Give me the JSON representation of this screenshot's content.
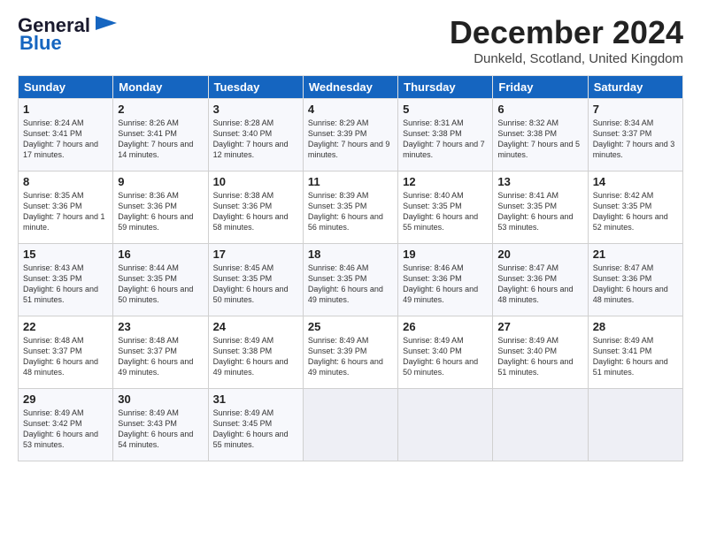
{
  "header": {
    "logo_line1": "General",
    "logo_line2": "Blue",
    "month": "December 2024",
    "location": "Dunkeld, Scotland, United Kingdom"
  },
  "weekdays": [
    "Sunday",
    "Monday",
    "Tuesday",
    "Wednesday",
    "Thursday",
    "Friday",
    "Saturday"
  ],
  "weeks": [
    [
      {
        "day": "1",
        "sunrise": "Sunrise: 8:24 AM",
        "sunset": "Sunset: 3:41 PM",
        "daylight": "Daylight: 7 hours and 17 minutes."
      },
      {
        "day": "2",
        "sunrise": "Sunrise: 8:26 AM",
        "sunset": "Sunset: 3:41 PM",
        "daylight": "Daylight: 7 hours and 14 minutes."
      },
      {
        "day": "3",
        "sunrise": "Sunrise: 8:28 AM",
        "sunset": "Sunset: 3:40 PM",
        "daylight": "Daylight: 7 hours and 12 minutes."
      },
      {
        "day": "4",
        "sunrise": "Sunrise: 8:29 AM",
        "sunset": "Sunset: 3:39 PM",
        "daylight": "Daylight: 7 hours and 9 minutes."
      },
      {
        "day": "5",
        "sunrise": "Sunrise: 8:31 AM",
        "sunset": "Sunset: 3:38 PM",
        "daylight": "Daylight: 7 hours and 7 minutes."
      },
      {
        "day": "6",
        "sunrise": "Sunrise: 8:32 AM",
        "sunset": "Sunset: 3:38 PM",
        "daylight": "Daylight: 7 hours and 5 minutes."
      },
      {
        "day": "7",
        "sunrise": "Sunrise: 8:34 AM",
        "sunset": "Sunset: 3:37 PM",
        "daylight": "Daylight: 7 hours and 3 minutes."
      }
    ],
    [
      {
        "day": "8",
        "sunrise": "Sunrise: 8:35 AM",
        "sunset": "Sunset: 3:36 PM",
        "daylight": "Daylight: 7 hours and 1 minute."
      },
      {
        "day": "9",
        "sunrise": "Sunrise: 8:36 AM",
        "sunset": "Sunset: 3:36 PM",
        "daylight": "Daylight: 6 hours and 59 minutes."
      },
      {
        "day": "10",
        "sunrise": "Sunrise: 8:38 AM",
        "sunset": "Sunset: 3:36 PM",
        "daylight": "Daylight: 6 hours and 58 minutes."
      },
      {
        "day": "11",
        "sunrise": "Sunrise: 8:39 AM",
        "sunset": "Sunset: 3:35 PM",
        "daylight": "Daylight: 6 hours and 56 minutes."
      },
      {
        "day": "12",
        "sunrise": "Sunrise: 8:40 AM",
        "sunset": "Sunset: 3:35 PM",
        "daylight": "Daylight: 6 hours and 55 minutes."
      },
      {
        "day": "13",
        "sunrise": "Sunrise: 8:41 AM",
        "sunset": "Sunset: 3:35 PM",
        "daylight": "Daylight: 6 hours and 53 minutes."
      },
      {
        "day": "14",
        "sunrise": "Sunrise: 8:42 AM",
        "sunset": "Sunset: 3:35 PM",
        "daylight": "Daylight: 6 hours and 52 minutes."
      }
    ],
    [
      {
        "day": "15",
        "sunrise": "Sunrise: 8:43 AM",
        "sunset": "Sunset: 3:35 PM",
        "daylight": "Daylight: 6 hours and 51 minutes."
      },
      {
        "day": "16",
        "sunrise": "Sunrise: 8:44 AM",
        "sunset": "Sunset: 3:35 PM",
        "daylight": "Daylight: 6 hours and 50 minutes."
      },
      {
        "day": "17",
        "sunrise": "Sunrise: 8:45 AM",
        "sunset": "Sunset: 3:35 PM",
        "daylight": "Daylight: 6 hours and 50 minutes."
      },
      {
        "day": "18",
        "sunrise": "Sunrise: 8:46 AM",
        "sunset": "Sunset: 3:35 PM",
        "daylight": "Daylight: 6 hours and 49 minutes."
      },
      {
        "day": "19",
        "sunrise": "Sunrise: 8:46 AM",
        "sunset": "Sunset: 3:36 PM",
        "daylight": "Daylight: 6 hours and 49 minutes."
      },
      {
        "day": "20",
        "sunrise": "Sunrise: 8:47 AM",
        "sunset": "Sunset: 3:36 PM",
        "daylight": "Daylight: 6 hours and 48 minutes."
      },
      {
        "day": "21",
        "sunrise": "Sunrise: 8:47 AM",
        "sunset": "Sunset: 3:36 PM",
        "daylight": "Daylight: 6 hours and 48 minutes."
      }
    ],
    [
      {
        "day": "22",
        "sunrise": "Sunrise: 8:48 AM",
        "sunset": "Sunset: 3:37 PM",
        "daylight": "Daylight: 6 hours and 48 minutes."
      },
      {
        "day": "23",
        "sunrise": "Sunrise: 8:48 AM",
        "sunset": "Sunset: 3:37 PM",
        "daylight": "Daylight: 6 hours and 49 minutes."
      },
      {
        "day": "24",
        "sunrise": "Sunrise: 8:49 AM",
        "sunset": "Sunset: 3:38 PM",
        "daylight": "Daylight: 6 hours and 49 minutes."
      },
      {
        "day": "25",
        "sunrise": "Sunrise: 8:49 AM",
        "sunset": "Sunset: 3:39 PM",
        "daylight": "Daylight: 6 hours and 49 minutes."
      },
      {
        "day": "26",
        "sunrise": "Sunrise: 8:49 AM",
        "sunset": "Sunset: 3:40 PM",
        "daylight": "Daylight: 6 hours and 50 minutes."
      },
      {
        "day": "27",
        "sunrise": "Sunrise: 8:49 AM",
        "sunset": "Sunset: 3:40 PM",
        "daylight": "Daylight: 6 hours and 51 minutes."
      },
      {
        "day": "28",
        "sunrise": "Sunrise: 8:49 AM",
        "sunset": "Sunset: 3:41 PM",
        "daylight": "Daylight: 6 hours and 51 minutes."
      }
    ],
    [
      {
        "day": "29",
        "sunrise": "Sunrise: 8:49 AM",
        "sunset": "Sunset: 3:42 PM",
        "daylight": "Daylight: 6 hours and 53 minutes."
      },
      {
        "day": "30",
        "sunrise": "Sunrise: 8:49 AM",
        "sunset": "Sunset: 3:43 PM",
        "daylight": "Daylight: 6 hours and 54 minutes."
      },
      {
        "day": "31",
        "sunrise": "Sunrise: 8:49 AM",
        "sunset": "Sunset: 3:45 PM",
        "daylight": "Daylight: 6 hours and 55 minutes."
      },
      null,
      null,
      null,
      null
    ]
  ]
}
